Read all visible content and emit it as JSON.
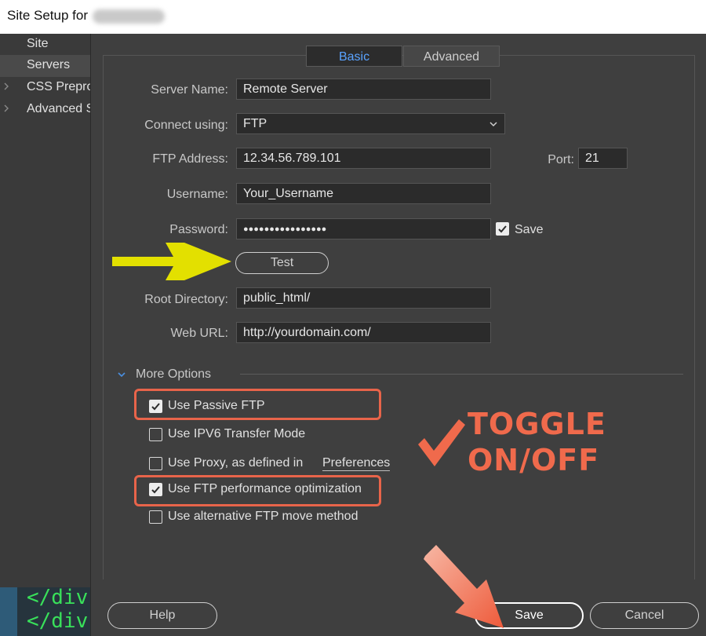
{
  "window": {
    "title": "Site Setup for"
  },
  "sidebar": {
    "items": [
      {
        "label": "Site"
      },
      {
        "label": "Servers"
      },
      {
        "label": "CSS Preprocessors"
      },
      {
        "label": "Advanced Settings"
      }
    ]
  },
  "code_preview": {
    "lines": [
      "</div",
      "</div"
    ]
  },
  "tabs": [
    {
      "label": "Basic"
    },
    {
      "label": "Advanced"
    }
  ],
  "form": {
    "server_name_label": "Server Name:",
    "server_name_value": "Remote Server",
    "connect_label": "Connect using:",
    "connect_value": "FTP",
    "ftp_address_label": "FTP Address:",
    "ftp_address_value": "12.34.56.789.101",
    "port_label": "Port:",
    "port_value": "21",
    "username_label": "Username:",
    "username_value": "Your_Username",
    "password_label": "Password:",
    "password_value": "●●●●●●●●●●●●●●●●",
    "save_password_label": "Save",
    "test_label": "Test",
    "root_dir_label": "Root Directory:",
    "root_dir_value": "public_html/",
    "web_url_label": "Web URL:",
    "web_url_value": "http://yourdomain.com/"
  },
  "more_options": {
    "title": "More Options",
    "passive_ftp": "Use Passive FTP",
    "ipv6": "Use IPV6 Transfer Mode",
    "proxy": "Use Proxy, as defined in",
    "preferences_link": "Preferences",
    "ftp_perf": "Use FTP performance optimization",
    "alt_move": "Use alternative FTP move method"
  },
  "buttons": {
    "help": "Help",
    "save": "Save",
    "cancel": "Cancel"
  },
  "annotation": {
    "line1": "TOGGLE",
    "line2": "ON/OFF"
  },
  "colors": {
    "accent": "#5aa3ff",
    "annotation": "#f06a4c",
    "arrow_yellow": "#e3e000"
  }
}
